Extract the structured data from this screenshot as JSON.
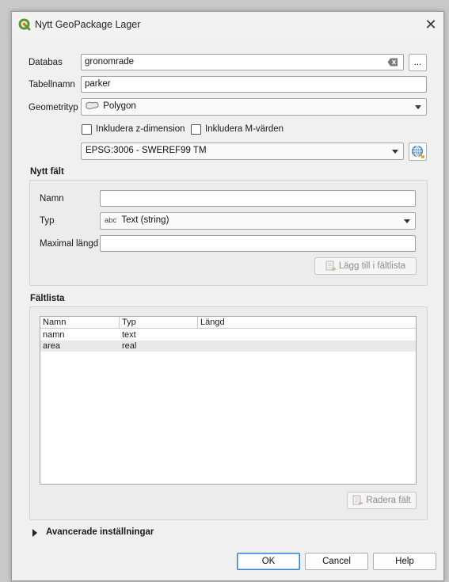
{
  "window": {
    "title": "Nytt GeoPackage Lager"
  },
  "form": {
    "database_label": "Databas",
    "database_value": "gronomrade",
    "browse_label": "...",
    "table_label": "Tabellnamn",
    "table_value": "parker",
    "geomtype_label": "Geometrityp",
    "geomtype_value": "Polygon",
    "include_z_label": "Inkludera z-dimension",
    "include_m_label": "Inkludera M-värden",
    "include_z_checked": false,
    "include_m_checked": false,
    "crs_value": "EPSG:3006 - SWEREF99 TM"
  },
  "new_field": {
    "title": "Nytt fält",
    "name_label": "Namn",
    "name_value": "",
    "type_label": "Typ",
    "type_prefix": "abc",
    "type_value": "Text (string)",
    "maxlen_label": "Maximal längd",
    "maxlen_value": "",
    "add_button": "Lägg till i fältlista"
  },
  "field_list": {
    "title": "Fältlista",
    "columns": [
      "Namn",
      "Typ",
      "Längd"
    ],
    "rows": [
      {
        "name": "namn",
        "type": "text",
        "length": ""
      },
      {
        "name": "area",
        "type": "real",
        "length": ""
      }
    ],
    "remove_button": "Radera fält"
  },
  "advanced": {
    "label": "Avancerade inställningar"
  },
  "buttons": {
    "ok": "OK",
    "cancel": "Cancel",
    "help": "Help"
  },
  "colors": {
    "default_button_border": "#2f7fd4",
    "qgis_green": "#589632"
  }
}
